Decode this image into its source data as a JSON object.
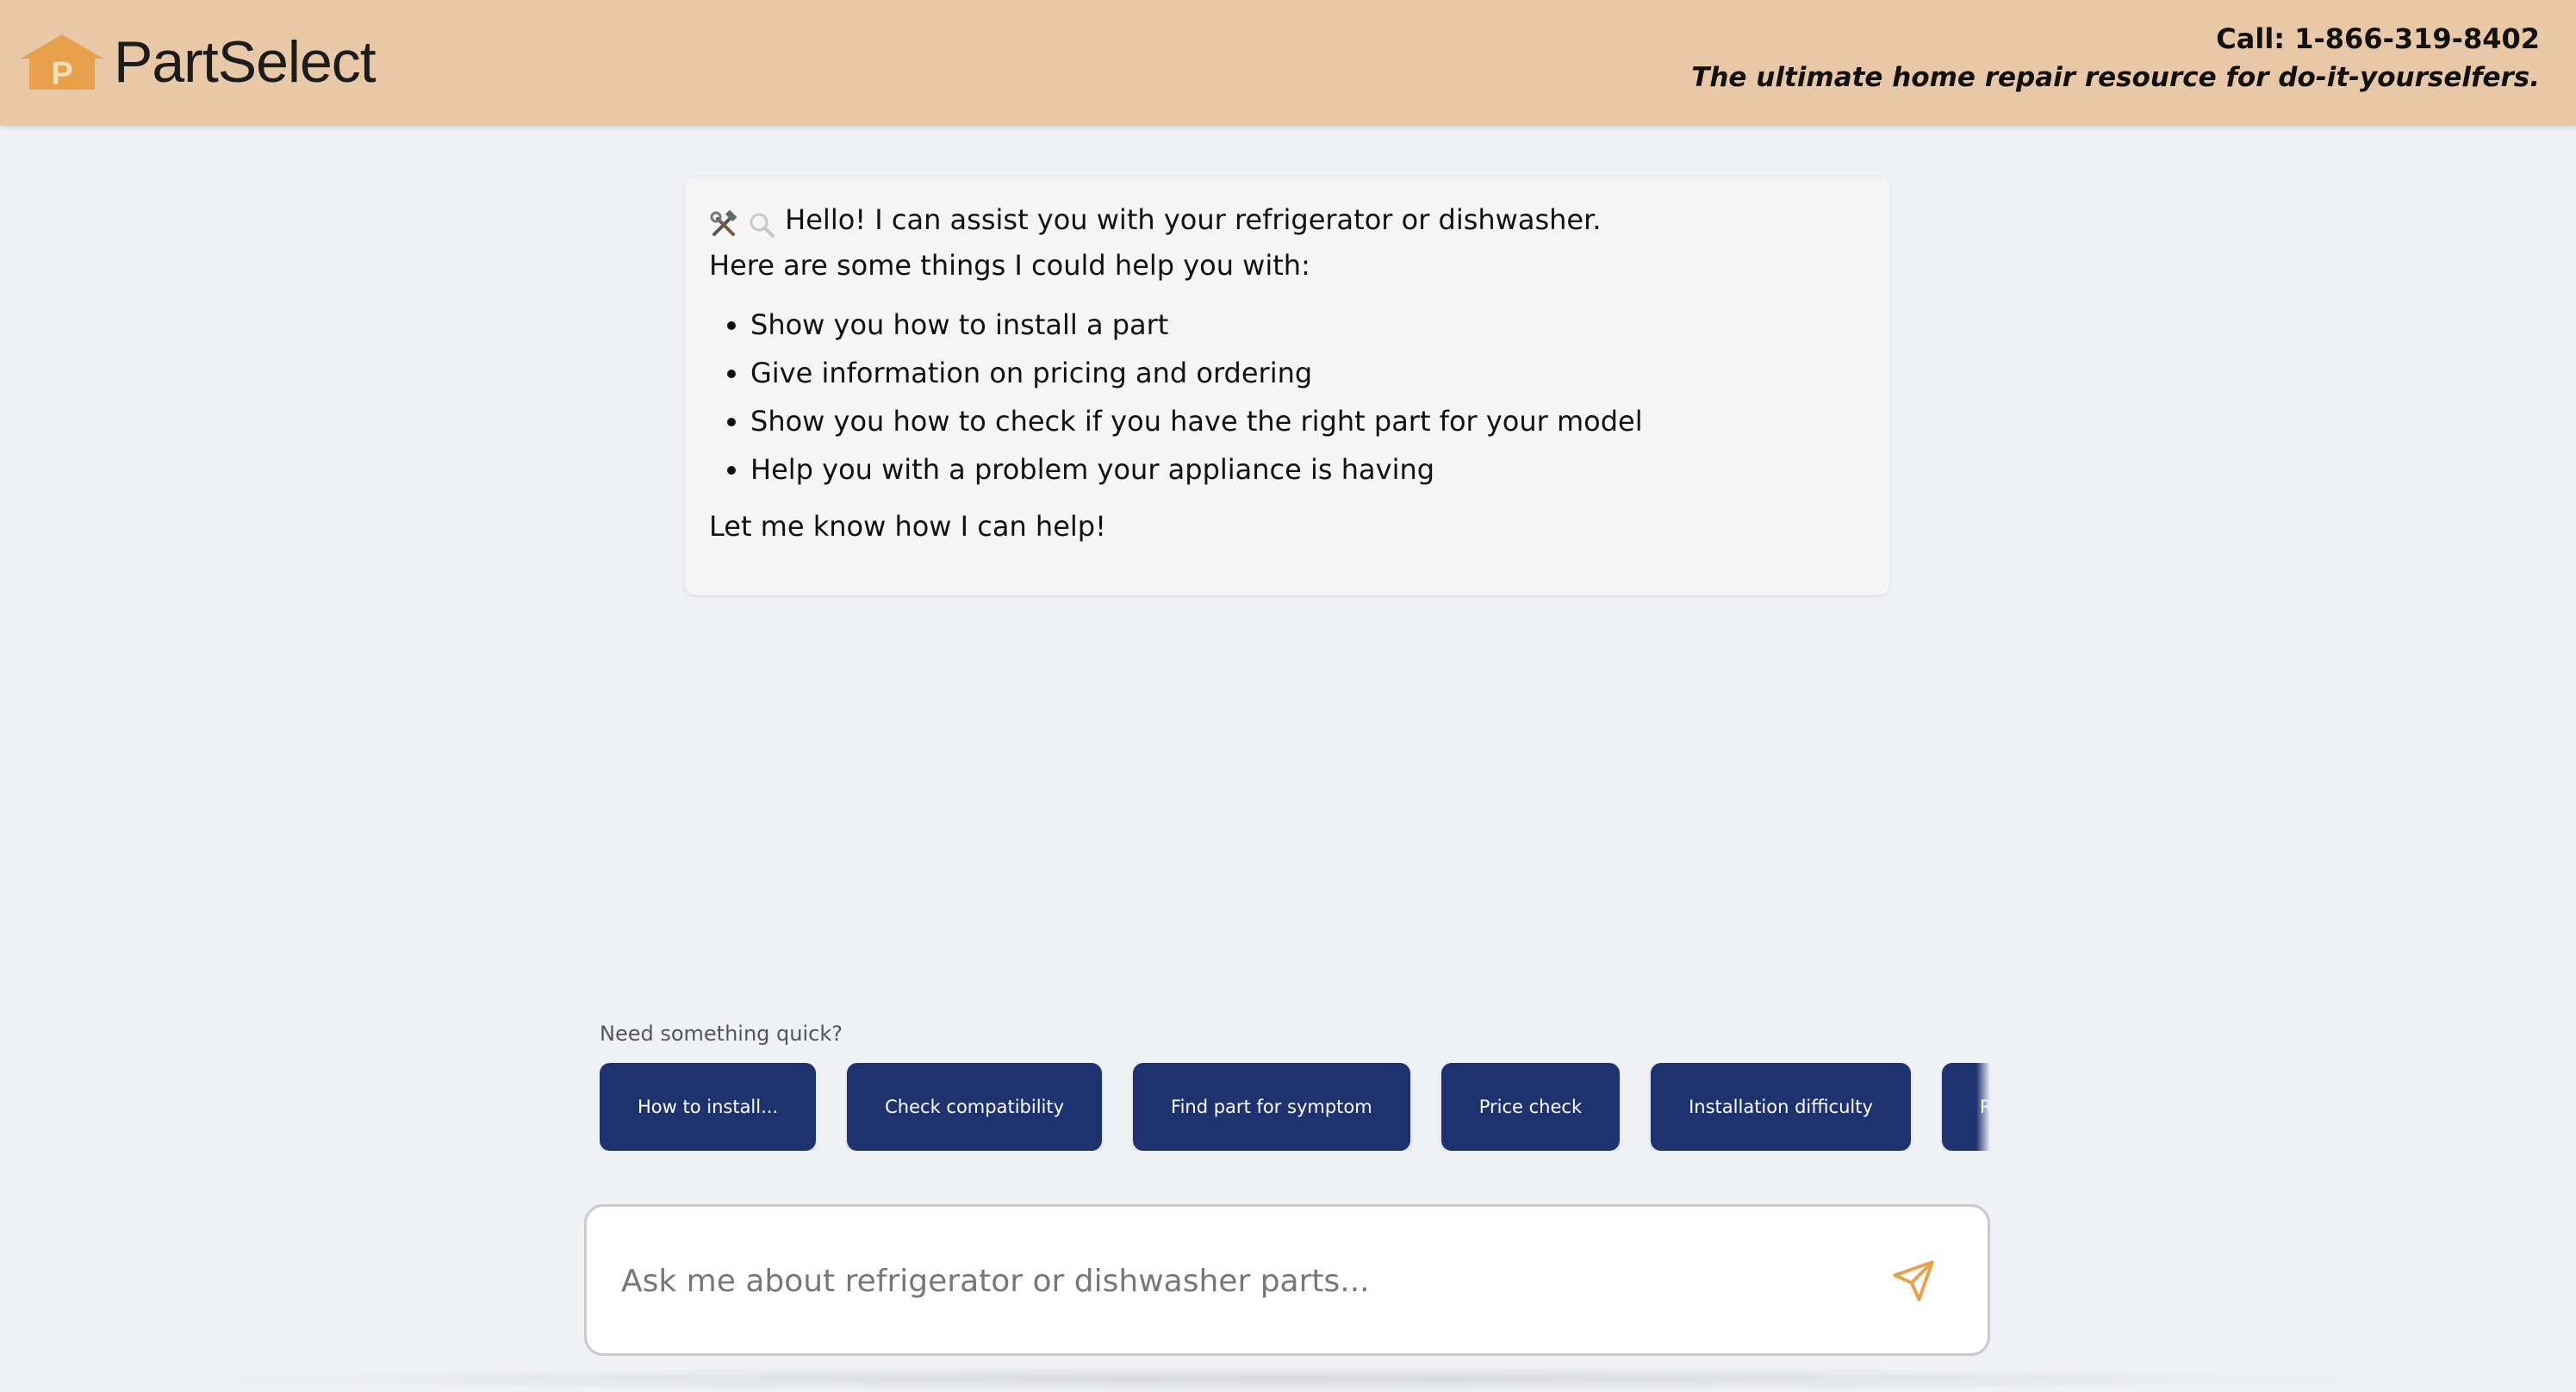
{
  "header": {
    "brand_name": "PartSelect",
    "logo_letter": "P",
    "phone": "Call: 1-866-319-8402",
    "tagline": "The ultimate home repair resource for do-it-yourselfers.",
    "background_color": "#e8c8a6",
    "logo_color": "#e8a04a"
  },
  "chat": {
    "assistant_message": {
      "icons": [
        "hammer-wrench-icon",
        "magnifier-icon"
      ],
      "greeting": "Hello! I can assist you with your refrigerator or dishwasher.",
      "intro": "Here are some things I could help you with:",
      "items": [
        "Show you how to install a part",
        "Give information on pricing and ordering",
        "Show you how to check if you have the right part for your model",
        "Help you with a problem your appliance is having"
      ],
      "closing": "Let me know how I can help!"
    }
  },
  "quick_actions": {
    "label": "Need something quick?",
    "chips": [
      "How to install...",
      "Check compatibility",
      "Find part for symptom",
      "Price check",
      "Installation difficulty",
      "Repair guide"
    ],
    "chip_color": "#1f3270"
  },
  "composer": {
    "placeholder": "Ask me about refrigerator or dishwasher parts...",
    "value": "",
    "send_icon": "send-icon",
    "accent_color": "#e8a04a"
  }
}
